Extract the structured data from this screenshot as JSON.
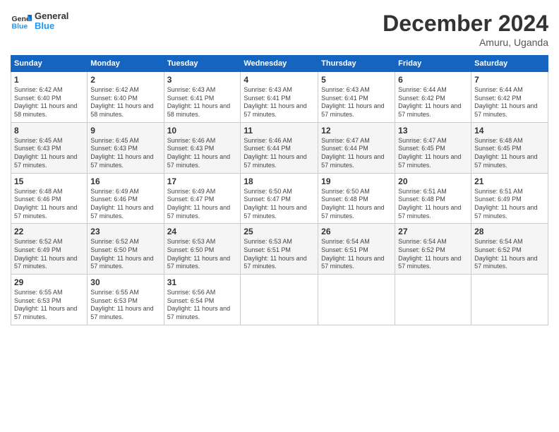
{
  "logo": {
    "line1": "General",
    "line2": "Blue"
  },
  "title": "December 2024",
  "location": "Amuru, Uganda",
  "days_of_week": [
    "Sunday",
    "Monday",
    "Tuesday",
    "Wednesday",
    "Thursday",
    "Friday",
    "Saturday"
  ],
  "weeks": [
    [
      {
        "day": "1",
        "sunrise": "6:42 AM",
        "sunset": "6:40 PM",
        "daylight": "11 hours and 58 minutes."
      },
      {
        "day": "2",
        "sunrise": "6:42 AM",
        "sunset": "6:40 PM",
        "daylight": "11 hours and 58 minutes."
      },
      {
        "day": "3",
        "sunrise": "6:43 AM",
        "sunset": "6:41 PM",
        "daylight": "11 hours and 58 minutes."
      },
      {
        "day": "4",
        "sunrise": "6:43 AM",
        "sunset": "6:41 PM",
        "daylight": "11 hours and 57 minutes."
      },
      {
        "day": "5",
        "sunrise": "6:43 AM",
        "sunset": "6:41 PM",
        "daylight": "11 hours and 57 minutes."
      },
      {
        "day": "6",
        "sunrise": "6:44 AM",
        "sunset": "6:42 PM",
        "daylight": "11 hours and 57 minutes."
      },
      {
        "day": "7",
        "sunrise": "6:44 AM",
        "sunset": "6:42 PM",
        "daylight": "11 hours and 57 minutes."
      }
    ],
    [
      {
        "day": "8",
        "sunrise": "6:45 AM",
        "sunset": "6:43 PM",
        "daylight": "11 hours and 57 minutes."
      },
      {
        "day": "9",
        "sunrise": "6:45 AM",
        "sunset": "6:43 PM",
        "daylight": "11 hours and 57 minutes."
      },
      {
        "day": "10",
        "sunrise": "6:46 AM",
        "sunset": "6:43 PM",
        "daylight": "11 hours and 57 minutes."
      },
      {
        "day": "11",
        "sunrise": "6:46 AM",
        "sunset": "6:44 PM",
        "daylight": "11 hours and 57 minutes."
      },
      {
        "day": "12",
        "sunrise": "6:47 AM",
        "sunset": "6:44 PM",
        "daylight": "11 hours and 57 minutes."
      },
      {
        "day": "13",
        "sunrise": "6:47 AM",
        "sunset": "6:45 PM",
        "daylight": "11 hours and 57 minutes."
      },
      {
        "day": "14",
        "sunrise": "6:48 AM",
        "sunset": "6:45 PM",
        "daylight": "11 hours and 57 minutes."
      }
    ],
    [
      {
        "day": "15",
        "sunrise": "6:48 AM",
        "sunset": "6:46 PM",
        "daylight": "11 hours and 57 minutes."
      },
      {
        "day": "16",
        "sunrise": "6:49 AM",
        "sunset": "6:46 PM",
        "daylight": "11 hours and 57 minutes."
      },
      {
        "day": "17",
        "sunrise": "6:49 AM",
        "sunset": "6:47 PM",
        "daylight": "11 hours and 57 minutes."
      },
      {
        "day": "18",
        "sunrise": "6:50 AM",
        "sunset": "6:47 PM",
        "daylight": "11 hours and 57 minutes."
      },
      {
        "day": "19",
        "sunrise": "6:50 AM",
        "sunset": "6:48 PM",
        "daylight": "11 hours and 57 minutes."
      },
      {
        "day": "20",
        "sunrise": "6:51 AM",
        "sunset": "6:48 PM",
        "daylight": "11 hours and 57 minutes."
      },
      {
        "day": "21",
        "sunrise": "6:51 AM",
        "sunset": "6:49 PM",
        "daylight": "11 hours and 57 minutes."
      }
    ],
    [
      {
        "day": "22",
        "sunrise": "6:52 AM",
        "sunset": "6:49 PM",
        "daylight": "11 hours and 57 minutes."
      },
      {
        "day": "23",
        "sunrise": "6:52 AM",
        "sunset": "6:50 PM",
        "daylight": "11 hours and 57 minutes."
      },
      {
        "day": "24",
        "sunrise": "6:53 AM",
        "sunset": "6:50 PM",
        "daylight": "11 hours and 57 minutes."
      },
      {
        "day": "25",
        "sunrise": "6:53 AM",
        "sunset": "6:51 PM",
        "daylight": "11 hours and 57 minutes."
      },
      {
        "day": "26",
        "sunrise": "6:54 AM",
        "sunset": "6:51 PM",
        "daylight": "11 hours and 57 minutes."
      },
      {
        "day": "27",
        "sunrise": "6:54 AM",
        "sunset": "6:52 PM",
        "daylight": "11 hours and 57 minutes."
      },
      {
        "day": "28",
        "sunrise": "6:54 AM",
        "sunset": "6:52 PM",
        "daylight": "11 hours and 57 minutes."
      }
    ],
    [
      {
        "day": "29",
        "sunrise": "6:55 AM",
        "sunset": "6:53 PM",
        "daylight": "11 hours and 57 minutes."
      },
      {
        "day": "30",
        "sunrise": "6:55 AM",
        "sunset": "6:53 PM",
        "daylight": "11 hours and 57 minutes."
      },
      {
        "day": "31",
        "sunrise": "6:56 AM",
        "sunset": "6:54 PM",
        "daylight": "11 hours and 57 minutes."
      },
      null,
      null,
      null,
      null
    ]
  ],
  "labels": {
    "sunrise": "Sunrise: ",
    "sunset": "Sunset: ",
    "daylight": "Daylight: "
  }
}
